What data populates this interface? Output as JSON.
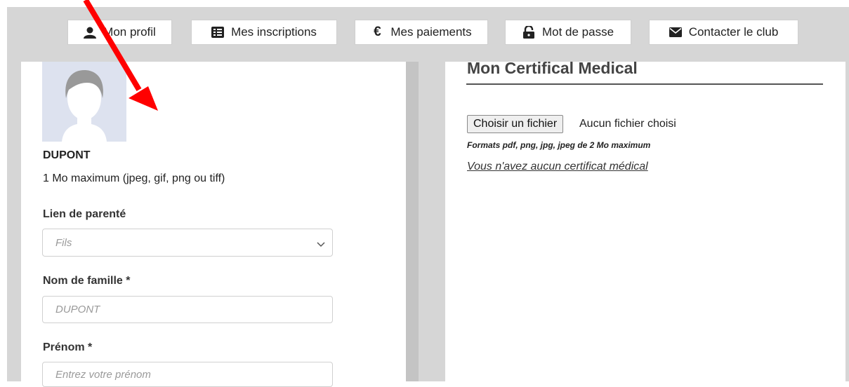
{
  "nav": {
    "items": [
      {
        "label": "Mon profil",
        "icon": "user-icon"
      },
      {
        "label": "Mes inscriptions",
        "icon": "list-icon"
      },
      {
        "label": "Mes paiements",
        "icon": "euro-icon",
        "glyph": "€"
      },
      {
        "label": "Mot de passe",
        "icon": "unlock-icon"
      },
      {
        "label": "Contacter le club",
        "icon": "envelope-icon"
      }
    ]
  },
  "profile": {
    "last_name_display": "DUPONT",
    "photo_hint": "1 Mo maximum (jpeg, gif, png ou tiff)",
    "relationship_label": "Lien de parenté",
    "relationship_value": "Fils",
    "lastname_label": "Nom de famille *",
    "lastname_value": "DUPONT",
    "firstname_label": "Prénom *",
    "firstname_placeholder": "Entrez votre prénom"
  },
  "certificate": {
    "title": "Mon Certifical Medical",
    "choose_file": "Choisir un fichier",
    "no_file": "Aucun fichier choisi",
    "formats": "Formats pdf, png, jpg, jpeg de 2 Mo maximum",
    "none_text": "Vous n'avez aucun certificat médical"
  },
  "colors": {
    "annotation_arrow": "#ff0000",
    "frame": "#d6d6d6"
  }
}
